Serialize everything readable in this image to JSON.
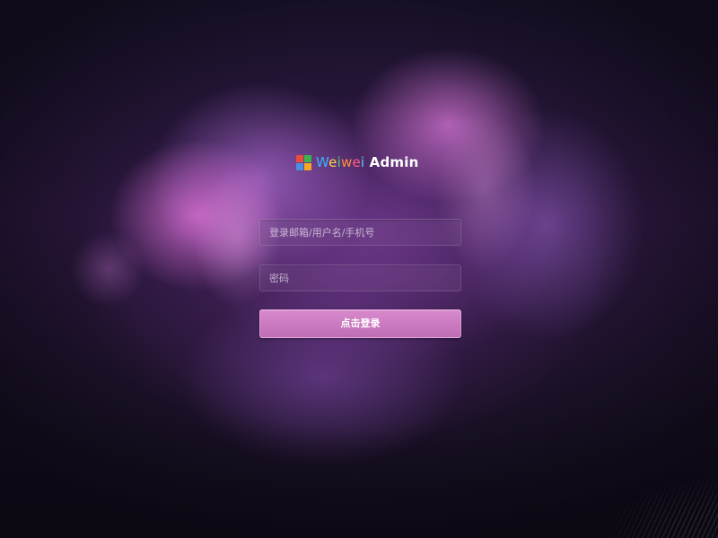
{
  "brand": {
    "logo_icon": "windows-tiles-icon",
    "logo_colors": [
      "#e84c3d",
      "#3cb44b",
      "#4a90e2",
      "#f5a623"
    ],
    "name_part_1": "W",
    "name_part_2": "e",
    "name_part_3": "i",
    "name_part_4": "w",
    "name_part_5": "e",
    "name_part_6": "i",
    "name_suffix": " Admin"
  },
  "login": {
    "username_placeholder": "登录邮箱/用户名/手机号",
    "username_value": "",
    "password_placeholder": "密码",
    "password_value": "",
    "submit_label": "点击登录"
  },
  "colors": {
    "button_accent": "#c978be",
    "background": "#1e1430"
  }
}
